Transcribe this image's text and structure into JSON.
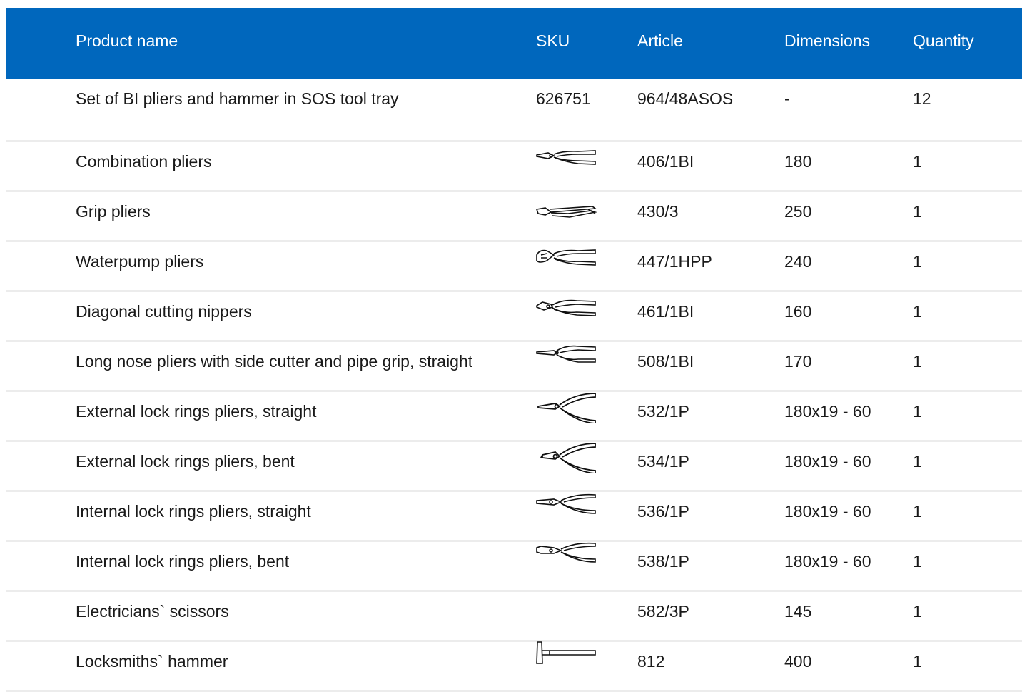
{
  "columns": {
    "name": "Product name",
    "sku": "SKU",
    "article": "Article",
    "dimensions": "Dimensions",
    "quantity": "Quantity"
  },
  "rows": [
    {
      "name": "Set of BI pliers and hammer in SOS tool tray",
      "sku": "626751",
      "sku_icon": "",
      "article": "964/48ASOS",
      "dimensions": "-",
      "quantity": "12"
    },
    {
      "name": "Combination pliers",
      "sku": "",
      "sku_icon": "combination-pliers-icon",
      "article": "406/1BI",
      "dimensions": "180",
      "quantity": "1"
    },
    {
      "name": "Grip pliers",
      "sku": "",
      "sku_icon": "grip-pliers-icon",
      "article": "430/3",
      "dimensions": "250",
      "quantity": "1"
    },
    {
      "name": "Waterpump pliers",
      "sku": "",
      "sku_icon": "waterpump-pliers-icon",
      "article": "447/1HPP",
      "dimensions": "240",
      "quantity": "1"
    },
    {
      "name": "Diagonal cutting nippers",
      "sku": "",
      "sku_icon": "diagonal-nippers-icon",
      "article": "461/1BI",
      "dimensions": "160",
      "quantity": "1"
    },
    {
      "name": "Long nose pliers with side cutter and pipe grip, straight",
      "sku": "",
      "sku_icon": "long-nose-pliers-icon",
      "article": "508/1BI",
      "dimensions": "170",
      "quantity": "1"
    },
    {
      "name": "External lock rings pliers, straight",
      "sku": "",
      "sku_icon": "circlip-pliers-icon",
      "article": "532/1P",
      "dimensions": "180x19 - 60",
      "quantity": "1"
    },
    {
      "name": "External lock rings pliers, bent",
      "sku": "",
      "sku_icon": "circlip-pliers-bent-icon",
      "article": "534/1P",
      "dimensions": "180x19 - 60",
      "quantity": "1"
    },
    {
      "name": "Internal lock rings pliers, straight",
      "sku": "",
      "sku_icon": "internal-circlip-pliers-icon",
      "article": "536/1P",
      "dimensions": "180x19 - 60",
      "quantity": "1"
    },
    {
      "name": "Internal lock rings pliers, bent",
      "sku": "",
      "sku_icon": "internal-circlip-pliers-bent-icon",
      "article": "538/1P",
      "dimensions": "180x19 - 60",
      "quantity": "1"
    },
    {
      "name": "Electricians` scissors",
      "sku": "",
      "sku_icon": "",
      "article": "582/3P",
      "dimensions": "145",
      "quantity": "1"
    },
    {
      "name": "Locksmiths` hammer",
      "sku": "",
      "sku_icon": "hammer-icon",
      "article": "812",
      "dimensions": "400",
      "quantity": "1"
    }
  ],
  "colors": {
    "header_bg": "#0067bd",
    "header_text": "#ffffff",
    "row_divider": "#ececec",
    "body_text": "#1a1a1a"
  }
}
